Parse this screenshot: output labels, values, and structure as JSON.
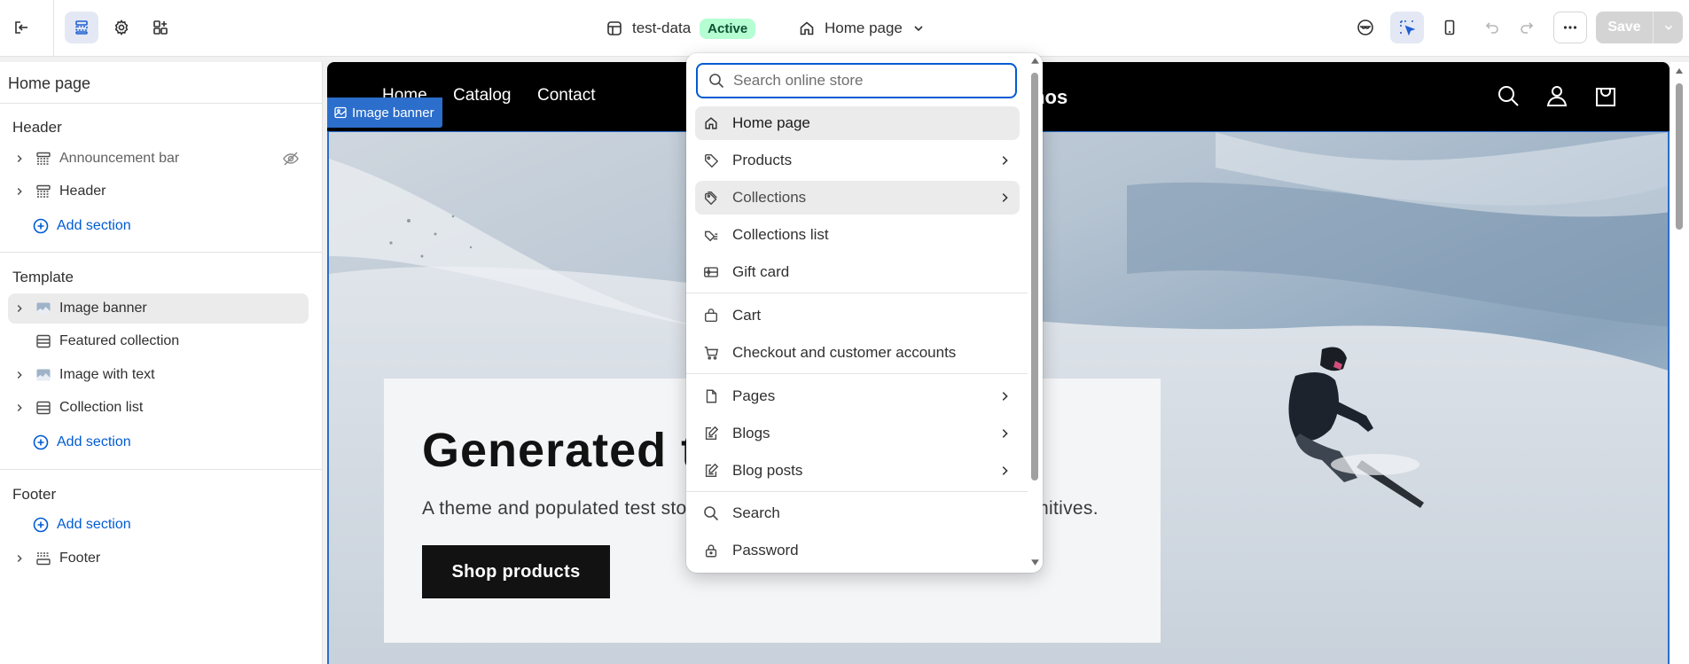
{
  "topbar": {
    "exit_icon": "exit-icon",
    "store_name": "test-data",
    "store_status": "Active",
    "current_page": "Home page",
    "save_label": "Save"
  },
  "sidebar": {
    "title": "Home page",
    "groups": [
      {
        "name": "Header",
        "items": [
          {
            "label": "Announcement bar",
            "icon": "section-icon",
            "hidden": true
          },
          {
            "label": "Header",
            "icon": "section-icon"
          }
        ],
        "add_label": "Add section"
      },
      {
        "name": "Template",
        "items": [
          {
            "label": "Image banner",
            "icon": "image-icon",
            "selected": true
          },
          {
            "label": "Featured collection",
            "icon": "section-icon"
          },
          {
            "label": "Image with text",
            "icon": "image-icon"
          },
          {
            "label": "Collection list",
            "icon": "section-icon"
          }
        ],
        "add_label": "Add section"
      },
      {
        "name": "Footer",
        "items": [
          {
            "label": "Footer",
            "icon": "section-icon"
          }
        ],
        "add_label": "Add section"
      }
    ]
  },
  "preview": {
    "nav": [
      "Home",
      "Catalog",
      "Contact"
    ],
    "logo": "mos",
    "image_tag": "Image banner",
    "heading": "Generated te",
    "text": "A theme and populated test sto",
    "text_tail": "rimitives.",
    "button": "Shop products"
  },
  "dropdown": {
    "search_placeholder": "Search online store",
    "items": [
      {
        "label": "Home page",
        "icon": "home-icon",
        "highlighted": true
      },
      {
        "label": "Products",
        "icon": "tag-icon",
        "has_submenu": true
      },
      {
        "label": "Collections",
        "icon": "collections-icon",
        "has_submenu": true,
        "hovered": true
      },
      {
        "label": "Collections list",
        "icon": "collections-list-icon"
      },
      {
        "label": "Gift card",
        "icon": "gift-card-icon"
      },
      {
        "label": "Cart",
        "icon": "bag-icon"
      },
      {
        "label": "Checkout and customer accounts",
        "icon": "cart-icon"
      },
      {
        "label": "Pages",
        "icon": "page-icon",
        "has_submenu": true
      },
      {
        "label": "Blogs",
        "icon": "blog-icon",
        "has_submenu": true
      },
      {
        "label": "Blog posts",
        "icon": "blog-post-icon",
        "has_submenu": true
      },
      {
        "label": "Search",
        "icon": "search-icon"
      },
      {
        "label": "Password",
        "icon": "lock-icon"
      }
    ]
  },
  "colors": {
    "accent": "#005bd3",
    "selection": "#2c6ecb",
    "active_badge_bg": "#b4fed2",
    "active_badge_text": "#0c5132"
  }
}
